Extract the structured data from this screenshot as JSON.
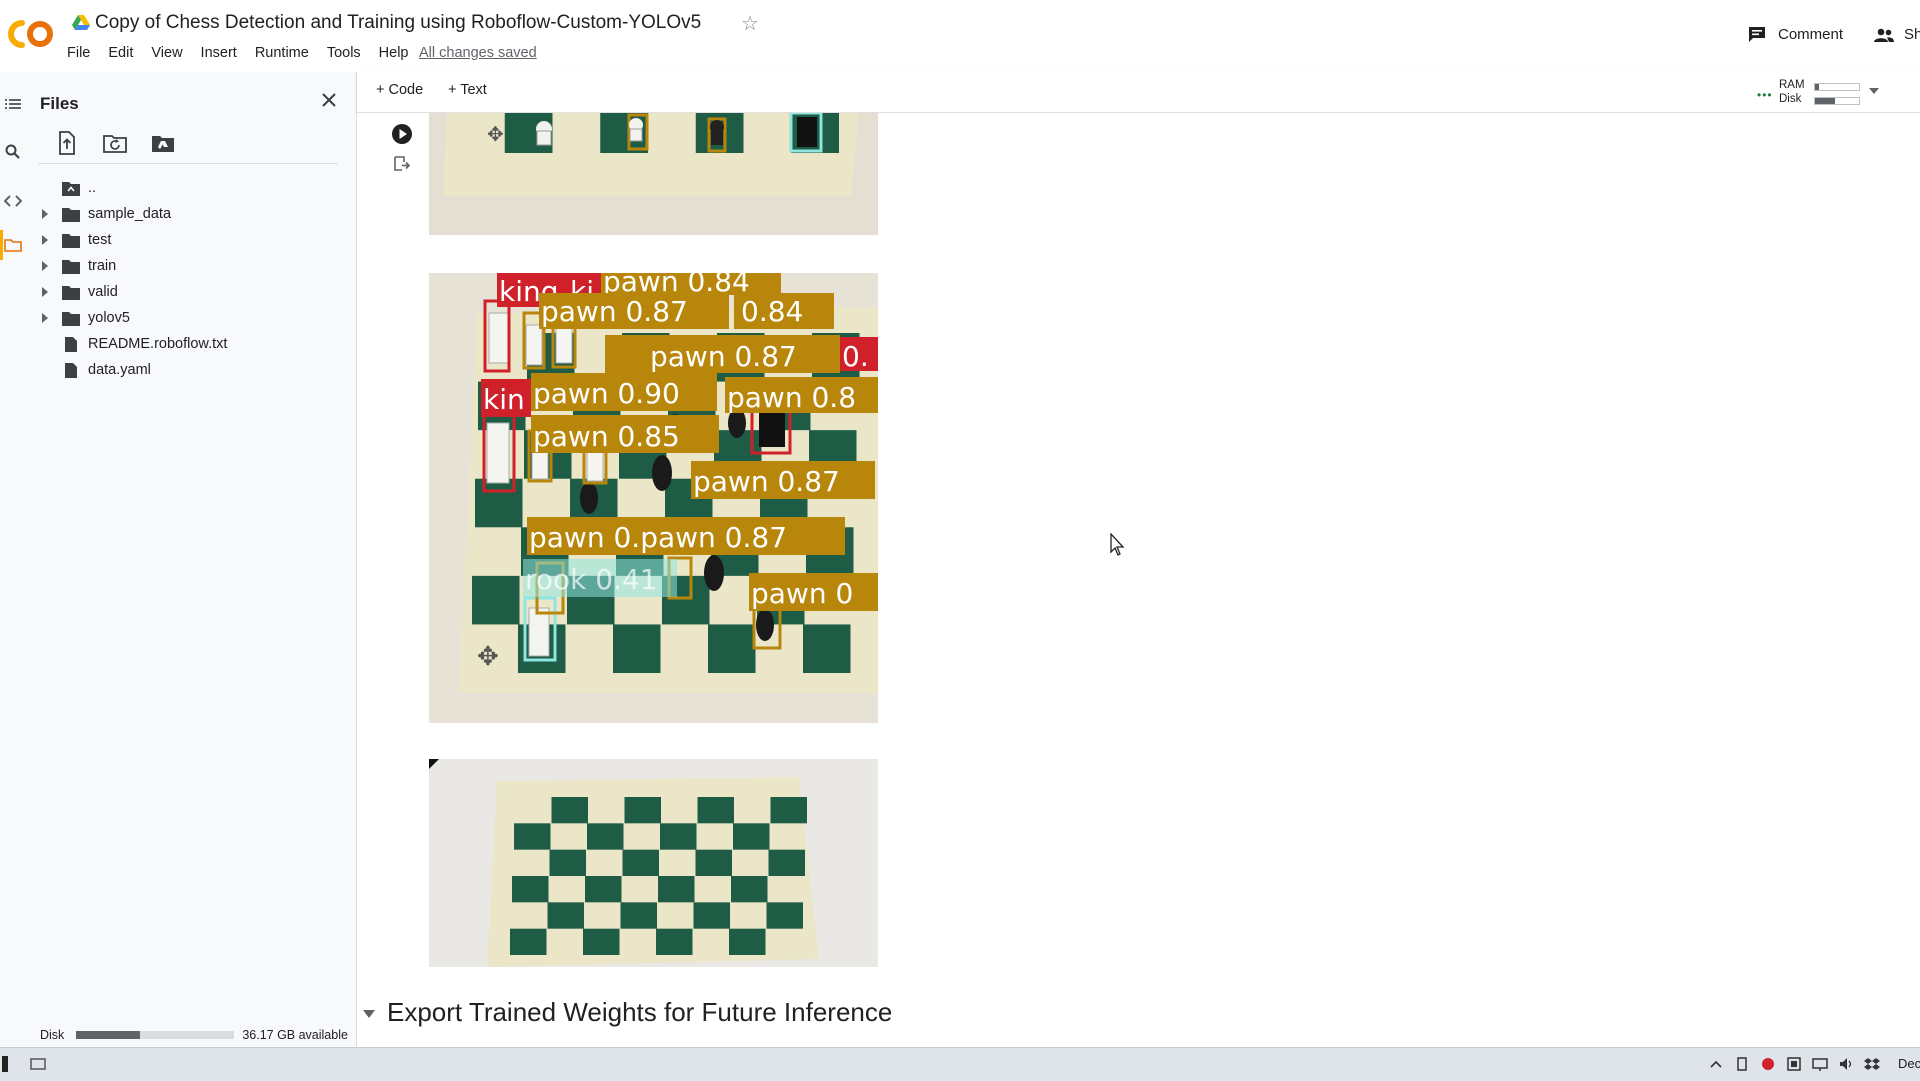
{
  "app": {
    "logo_text": "CO",
    "title": "Copy of Chess Detection and Training using Roboflow-Custom-YOLOv5",
    "saved_status": "All changes saved"
  },
  "menu": {
    "items": [
      {
        "label": "File"
      },
      {
        "label": "Edit"
      },
      {
        "label": "View"
      },
      {
        "label": "Insert"
      },
      {
        "label": "Runtime"
      },
      {
        "label": "Tools"
      },
      {
        "label": "Help"
      }
    ]
  },
  "header_actions": {
    "comment_label": "Comment",
    "share_label": "Sh"
  },
  "files_panel": {
    "title": "Files",
    "toolbar_icons": [
      "upload-file-icon",
      "refresh-folder-icon",
      "mount-drive-icon"
    ],
    "tree": [
      {
        "name": "..",
        "type": "parent",
        "expandable": false
      },
      {
        "name": "sample_data",
        "type": "folder",
        "expandable": true
      },
      {
        "name": "test",
        "type": "folder",
        "expandable": true
      },
      {
        "name": "train",
        "type": "folder",
        "expandable": true
      },
      {
        "name": "valid",
        "type": "folder",
        "expandable": true
      },
      {
        "name": "yolov5",
        "type": "folder",
        "expandable": true
      },
      {
        "name": "README.roboflow.txt",
        "type": "file",
        "expandable": false
      },
      {
        "name": "data.yaml",
        "type": "file",
        "expandable": false
      }
    ],
    "disk": {
      "label": "Disk",
      "used_fraction": 0.4,
      "available": "36.17 GB available"
    }
  },
  "notebook_toolbar": {
    "add_code": "+ Code",
    "add_text": "+ Text",
    "resources": {
      "ram_label": "RAM",
      "disk_label": "Disk",
      "ram_fraction": 0.1,
      "disk_fraction": 0.45
    }
  },
  "output": {
    "detections": [
      {
        "text": "king"
      },
      {
        "text": "ki"
      },
      {
        "text": "pawn 0.84"
      },
      {
        "text": "pawn 0.87"
      },
      {
        "text": "0.84"
      },
      {
        "text": "pawn 0.87"
      },
      {
        "text": "0."
      },
      {
        "text": "kin"
      },
      {
        "text": "pawn 0.90"
      },
      {
        "text": "pawn 0.8"
      },
      {
        "text": "pawn 0.85"
      },
      {
        "text": "pawn 0.87"
      },
      {
        "text": "pawn 0.pawn 0.87"
      },
      {
        "text": "rook 0.41"
      },
      {
        "text": "pawn 0"
      }
    ]
  },
  "section": {
    "title": "Export Trained Weights for Future Inference"
  },
  "colors": {
    "colab_orange": "#f9ab00",
    "pawn_label": "#b8860b",
    "king_label": "#d0202a",
    "rook_label": "#8fe5e0",
    "board_green": "#1e5c46",
    "board_cream": "#ece6c8"
  },
  "taskbar": {
    "clock_text": "Dec"
  }
}
